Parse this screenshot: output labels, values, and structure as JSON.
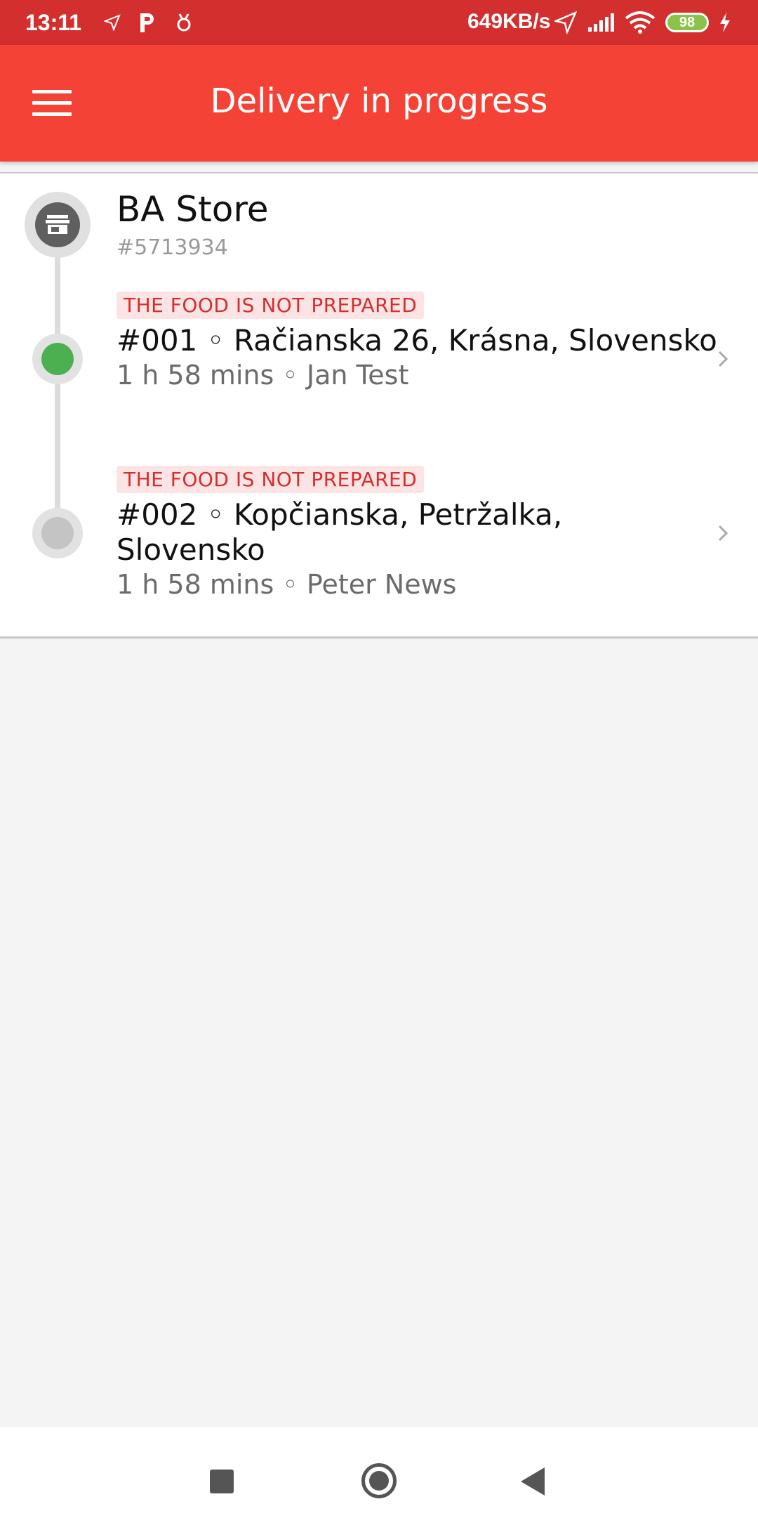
{
  "status_bar": {
    "time": "13:11",
    "network_speed": "649KB/s",
    "battery_level": "98"
  },
  "app_bar": {
    "title": "Delivery in progress"
  },
  "store": {
    "name": "BA Store",
    "id": "#5713934"
  },
  "orders": [
    {
      "status": "THE FOOD IS NOT PREPARED",
      "title": "#001 ◦ Račianska 26, Krásna, Slovensko",
      "meta": "1 h 58 mins ◦ Jan Test",
      "node_color": "#4caf50"
    },
    {
      "status": "THE FOOD IS NOT PREPARED",
      "title": "#002 ◦ Kopčianska, Petržalka, Slovensko",
      "meta": "1 h 58 mins ◦ Peter News",
      "node_color": "#c4c4c4"
    }
  ],
  "colors": {
    "status_bar": "#d32f2f",
    "app_bar": "#f44336",
    "badge_text": "#d32f2f",
    "badge_bg": "#fde4e4"
  }
}
